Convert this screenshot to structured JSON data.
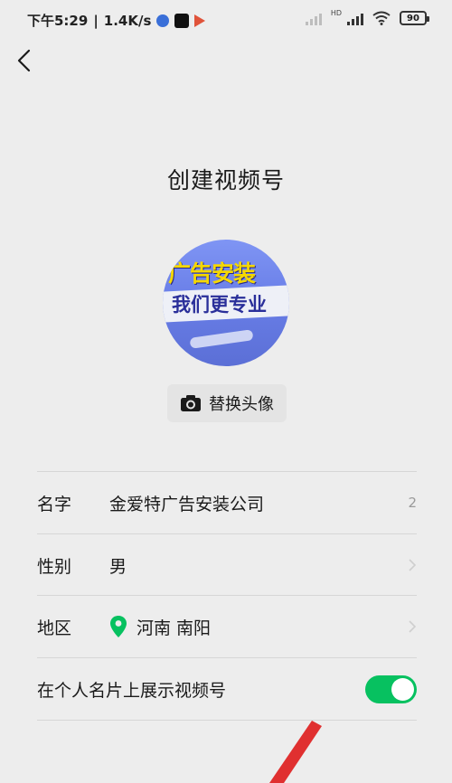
{
  "status_bar": {
    "time": "下午5:29",
    "speed": "1.4K/s",
    "battery": "90"
  },
  "header": {
    "title": "创建视频号"
  },
  "avatar": {
    "line1": "广告安装",
    "line2": "我们更专业",
    "change_label": "替换头像"
  },
  "form": {
    "name": {
      "label": "名字",
      "value": "金爱特广告安装公司",
      "count": "2"
    },
    "gender": {
      "label": "性别",
      "value": "男"
    },
    "region": {
      "label": "地区",
      "value": "河南 南阳"
    },
    "show_on_card": {
      "label": "在个人名片上展示视频号",
      "enabled": true
    }
  },
  "colors": {
    "accent": "#07c160",
    "background": "#ededed",
    "annotation": "#e03030"
  }
}
